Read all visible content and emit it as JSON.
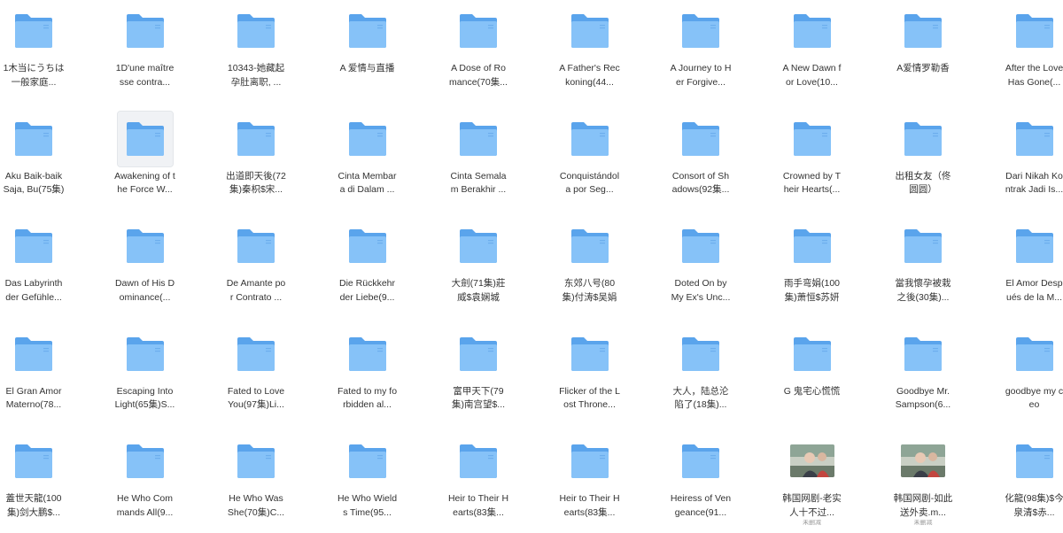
{
  "files": [
    {
      "name": "1木当にうちは一般家庭...",
      "type": "folder"
    },
    {
      "name": "1D'une maîtresse contra...",
      "type": "folder"
    },
    {
      "name": "10343-她藏起孕肚离职, ...",
      "type": "folder"
    },
    {
      "name": "A 爱情与直播",
      "type": "folder"
    },
    {
      "name": "A Dose of Romance(70集...",
      "type": "folder"
    },
    {
      "name": "A Father's Reckoning(44...",
      "type": "folder"
    },
    {
      "name": "A Journey to Her Forgive...",
      "type": "folder"
    },
    {
      "name": "A New Dawn for Love(10...",
      "type": "folder"
    },
    {
      "name": "A爱情罗勒香",
      "type": "folder"
    },
    {
      "name": "After the Love Has Gone(...",
      "type": "folder"
    },
    {
      "name": "Aku Baik-baik Saja, Bu(75集)",
      "type": "folder"
    },
    {
      "name": "Awakening of the Force W...",
      "type": "folder",
      "selected": true
    },
    {
      "name": "出道即天後(72集)秦枳$宋...",
      "type": "folder"
    },
    {
      "name": "Cinta Membara di Dalam ...",
      "type": "folder"
    },
    {
      "name": "Cinta Semalam Berakhir ...",
      "type": "folder"
    },
    {
      "name": "Conquistándola por Seg...",
      "type": "folder"
    },
    {
      "name": "Consort of Shadows(92集...",
      "type": "folder"
    },
    {
      "name": "Crowned by Their Hearts(...",
      "type": "folder"
    },
    {
      "name": "出租女友（佟圆圆）",
      "type": "folder"
    },
    {
      "name": "Dari Nikah Kontrak Jadi Is...",
      "type": "folder"
    },
    {
      "name": "Das Labyrinth der Gefühle...",
      "type": "folder"
    },
    {
      "name": "Dawn of His Dominance(...",
      "type": "folder"
    },
    {
      "name": "De Amante por Contrato ...",
      "type": "folder"
    },
    {
      "name": "Die Rückkehr der Liebe(9...",
      "type": "folder"
    },
    {
      "name": "大劍(71集)莊威$袁娴城",
      "type": "folder"
    },
    {
      "name": "东郊八号(80集)付涛$吴娟",
      "type": "folder"
    },
    {
      "name": "Doted On by My Ex's Unc...",
      "type": "folder"
    },
    {
      "name": "雨手弯娟(100集)萧恒$苏妍",
      "type": "folder"
    },
    {
      "name": "當我懷孕被栽之後(30集)...",
      "type": "folder"
    },
    {
      "name": "El Amor Después de la M...",
      "type": "folder"
    },
    {
      "name": "El Gran Amor Materno(78...",
      "type": "folder"
    },
    {
      "name": "Escaping Into Light(65集)S...",
      "type": "folder"
    },
    {
      "name": "Fated to Love You(97集)Li...",
      "type": "folder"
    },
    {
      "name": "Fated to my forbidden al...",
      "type": "folder"
    },
    {
      "name": "富甲天下(79集)南宫望$...",
      "type": "folder"
    },
    {
      "name": "Flicker of the Lost Throne...",
      "type": "folder"
    },
    {
      "name": "大人，陆总沦陷了(18集)...",
      "type": "folder"
    },
    {
      "name": "G 鬼宅心慌慌",
      "type": "folder"
    },
    {
      "name": "Goodbye Mr. Sampson(6...",
      "type": "folder"
    },
    {
      "name": "goodbye my ceo",
      "type": "folder"
    },
    {
      "name": "蓋世天龍(100集)剑大鹏$...",
      "type": "folder"
    },
    {
      "name": "He Who Commands All(9...",
      "type": "folder"
    },
    {
      "name": "He Who Was She(70集)C...",
      "type": "folder"
    },
    {
      "name": "He Who Wields Time(95...",
      "type": "folder"
    },
    {
      "name": "Heir to Their Hearts(83集...",
      "type": "folder"
    },
    {
      "name": "Heir to Their Hearts(83集...",
      "type": "folder"
    },
    {
      "name": "Heiress of Vengeance(91...",
      "type": "folder"
    },
    {
      "name": "韩国网剧-老实人十不过...",
      "type": "video",
      "sub": "未删减"
    },
    {
      "name": "韩国网剧-如此送外卖.m...",
      "type": "video",
      "sub": "未删减"
    },
    {
      "name": "化龍(98集)$今泉清$赤...",
      "type": "folder"
    }
  ],
  "colors": {
    "folder_back": "#5aa4ec",
    "folder_front": "#86c2f8",
    "label_text": "#333333",
    "selected_bg": "#f0f2f5"
  }
}
